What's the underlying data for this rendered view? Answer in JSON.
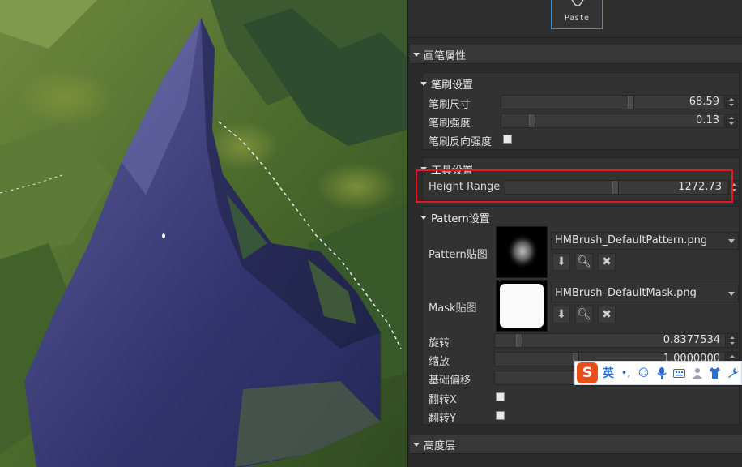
{
  "toolbar": {
    "paste_label": "Paste"
  },
  "sections": {
    "brush_props": "画笔属性",
    "height_layer": "高度层"
  },
  "brush_settings": {
    "title": "笔刷设置",
    "size_label": "笔刷尺寸",
    "size_value": "68.59",
    "size_fraction": 0.59,
    "strength_label": "笔刷强度",
    "strength_value": "0.13",
    "strength_fraction": 0.13,
    "invert_label": "笔刷反向强度"
  },
  "tool_settings": {
    "title": "工具设置",
    "height_range_label": "Height Range",
    "height_range_value": "1272.73",
    "height_range_fraction": 0.5
  },
  "pattern_settings": {
    "title": "Pattern设置",
    "pattern_tex_label": "Pattern贴图",
    "pattern_tex_file": "HMBrush_DefaultPattern.png",
    "mask_tex_label": "Mask贴图",
    "mask_tex_file": "HMBrush_DefaultMask.png",
    "rotate_label": "旋转",
    "rotate_value": "0.8377534",
    "scale_label": "缩放",
    "scale_value": "1.0000000",
    "offset_label": "基础偏移",
    "flip_x_label": "翻转X",
    "flip_y_label": "翻转Y"
  },
  "ime": {
    "logo": "S",
    "mode": "英",
    "icons": [
      "punctuation-icon",
      "emoji-icon",
      "microphone-icon",
      "keyboard-icon",
      "user-icon",
      "skin-icon",
      "tools-icon"
    ]
  },
  "colors": {
    "highlight": "#e01b1b",
    "selection_border": "#3d8fd6",
    "ime_accent": "#2b6fd6",
    "ime_logo": "#e94e1b"
  }
}
